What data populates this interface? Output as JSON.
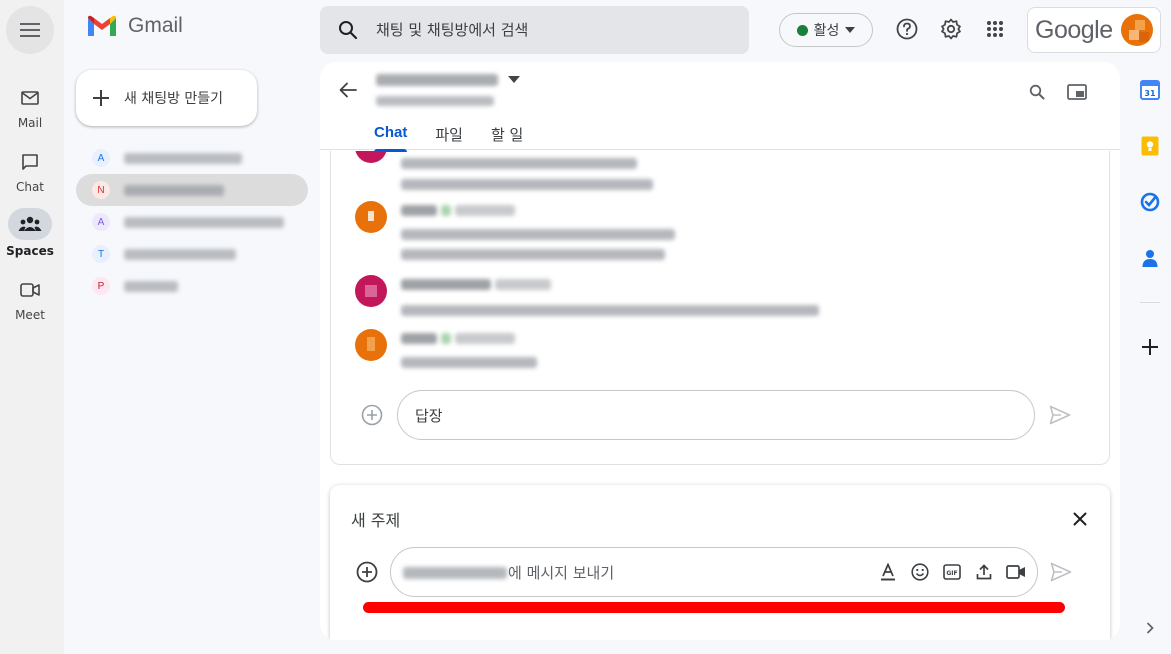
{
  "brand": {
    "name": "Gmail"
  },
  "rail": {
    "items": [
      {
        "label": "Mail",
        "icon": "mail-icon"
      },
      {
        "label": "Chat",
        "icon": "chat-icon"
      },
      {
        "label": "Spaces",
        "icon": "spaces-icon",
        "active": true
      },
      {
        "label": "Meet",
        "icon": "meet-icon"
      }
    ]
  },
  "new_space_button": {
    "label": "새 채팅방 만들기"
  },
  "space_list": {
    "items": [
      {
        "initial": "A",
        "color": "#1a73e8",
        "bg": "#e8f0fe"
      },
      {
        "initial": "N",
        "color": "#d93025",
        "bg": "#fce8e6",
        "selected": true
      },
      {
        "initial": "A",
        "color": "#7b5cd6",
        "bg": "#eee8fd"
      },
      {
        "initial": "T",
        "color": "#1a73e8",
        "bg": "#e8f0fe"
      },
      {
        "initial": "P",
        "color": "#c5221f",
        "bg": "#fde7f3"
      }
    ]
  },
  "search": {
    "placeholder": "채팅 및 채팅방에서 검색"
  },
  "status": {
    "label": "활성",
    "color": "#188038"
  },
  "account": {
    "brand_text": "Google"
  },
  "chat": {
    "tabs": [
      {
        "label": "Chat",
        "active": true
      },
      {
        "label": "파일"
      },
      {
        "label": "할 일"
      }
    ],
    "reply_placeholder": "답장"
  },
  "new_topic": {
    "title": "새 주제",
    "compose_suffix": "에 메시지 보내기"
  },
  "colors": {
    "accent": "#0b57d0",
    "highlight_bar": "#ff0000"
  }
}
